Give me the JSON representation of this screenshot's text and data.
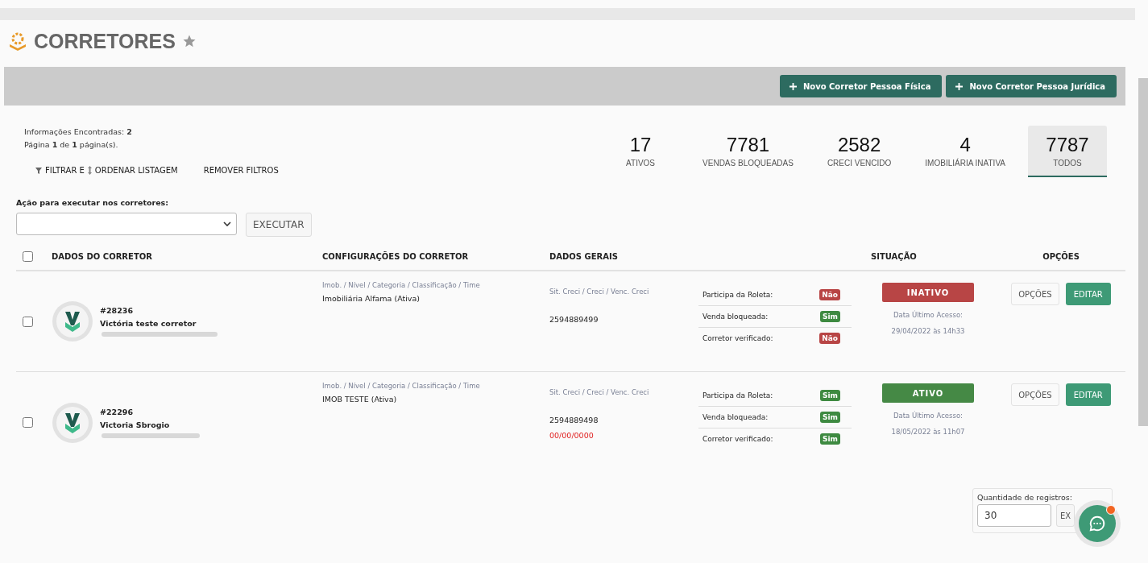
{
  "page": {
    "title": "CORRETORES"
  },
  "actions": [
    {
      "label": "Novo Corretor Pessoa Física"
    },
    {
      "label": "Novo Corretor Pessoa Jurídica"
    }
  ],
  "summary": {
    "found_label": "Informações Encontradas:",
    "found": "2",
    "page_text": "Página **1** de **1** página(s)."
  },
  "filters": [
    {
      "kind": "filter",
      "label": "FILTRAR E"
    },
    {
      "kind": "sort",
      "label": "ORDENAR LISTAGEM"
    },
    {
      "kind": "plain",
      "label": "REMOVER FILTROS"
    }
  ],
  "stats": [
    {
      "value": "17",
      "label": "ATIVOS",
      "selected": false
    },
    {
      "value": "7781",
      "label": "VENDAS BLOQUEADAS",
      "selected": false
    },
    {
      "value": "2582",
      "label": "CRECI VENCIDO",
      "selected": false
    },
    {
      "value": "4",
      "label": "IMOBILIÁRIA INATIVA",
      "selected": false
    },
    {
      "value": "7787",
      "label": "TODOS",
      "selected": true
    }
  ],
  "bulk": {
    "label": "Ação para executar nos corretores:",
    "button": "EXECUTAR"
  },
  "table": {
    "select_all_checked": false,
    "columns": [
      "DADOS DO CORRETOR",
      "CONFIGURAÇÕES DO CORRETOR",
      "DADOS GERAIS",
      "SITUAÇÃO",
      "OPÇÕES"
    ],
    "rows": [
      {
        "checked": false,
        "id": "#28236",
        "name": "Victória teste corretor",
        "config_hint": "Imob. / Nível / Categoria / Classificação / Time",
        "config": "Imobiliária Alfama (Ativa)",
        "creci_hint": "Sit. Creci / Creci / Venc. Creci",
        "creci": "2594889499",
        "flags": [
          {
            "label": "Participa da Roleta:",
            "value": "Não",
            "positive": false
          },
          {
            "label": "Venda bloqueada:",
            "value": "Sim",
            "positive": true
          },
          {
            "label": "Corretor verificado:",
            "value": "Não",
            "positive": false
          }
        ],
        "status": "INATIVO",
        "active": false,
        "access_label": "Data Último Acesso:",
        "access": "29/04/2022 às 14h33",
        "options": "OPÇÕES",
        "edit": "EDITAR"
      },
      {
        "checked": false,
        "id": "#22296",
        "name": "Victoria Sbrogio",
        "config_hint": "Imob. / Nível / Categoria / Classificação / Time",
        "config": "IMOB TESTE (Ativa)",
        "creci_hint": "Sit. Creci / Creci / Venc. Creci",
        "creci": "2594889498",
        "creci_expiry": "00/00/0000",
        "flags": [
          {
            "label": "Participa da Roleta:",
            "value": "Sim",
            "positive": true
          },
          {
            "label": "Venda bloqueada:",
            "value": "Sim",
            "positive": true
          },
          {
            "label": "Corretor verificado:",
            "value": "Sim",
            "positive": true
          }
        ],
        "status": "ATIVO",
        "active": true,
        "access_label": "Data Último Acesso:",
        "access": "18/05/2022 às 11h07",
        "options": "OPÇÕES",
        "edit": "EDITAR"
      }
    ]
  },
  "page_size": {
    "label": "Quantidade de registros:",
    "value": "30",
    "button": "EX"
  }
}
